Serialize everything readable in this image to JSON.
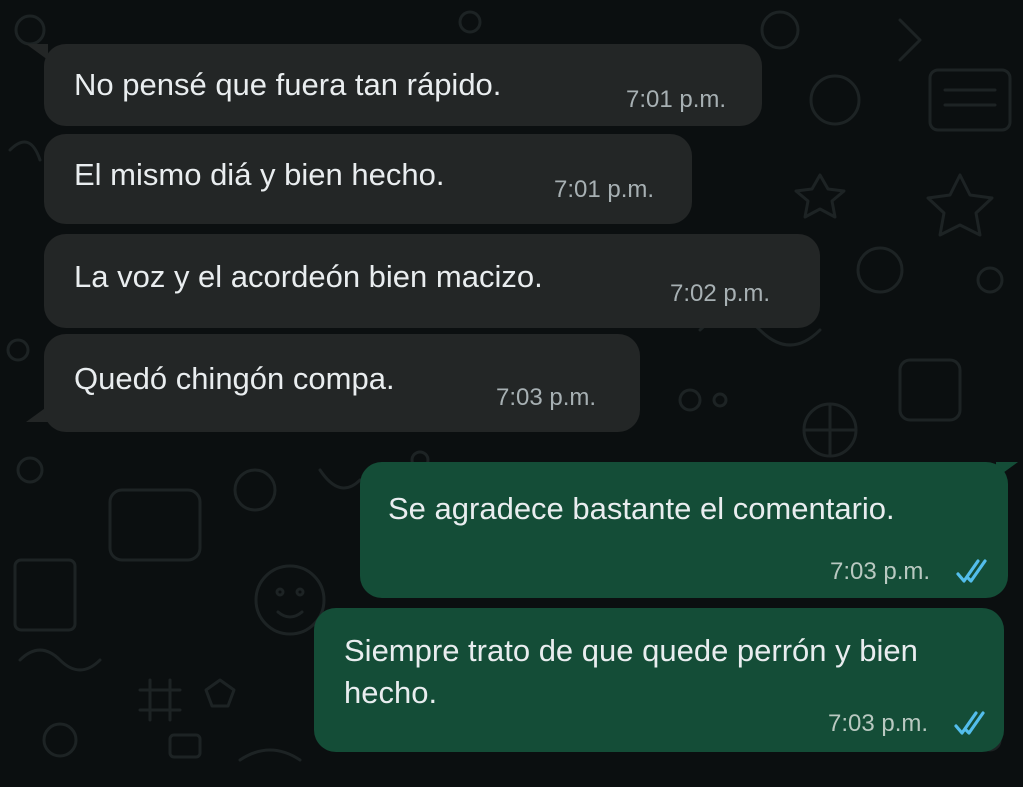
{
  "theme": {
    "incoming_bubble": "#232626",
    "outgoing_bubble": "#144d37",
    "text_color": "#e9edef",
    "read_tick_color": "#53bdeb",
    "background": "#0b0f10"
  },
  "messages": [
    {
      "direction": "incoming",
      "text": "No pensé que fuera tan rápido.",
      "time": "7:01 p.m."
    },
    {
      "direction": "incoming",
      "text": "El mismo diá y bien hecho.",
      "time": "7:01 p.m."
    },
    {
      "direction": "incoming",
      "text": "La voz y el acordeón bien macizo.",
      "time": "7:02 p.m."
    },
    {
      "direction": "incoming",
      "text": "Quedó chingón compa.",
      "time": "7:03 p.m."
    },
    {
      "direction": "outgoing",
      "text": "Se agradece bastante el comentario.",
      "time": "7:03 p.m.",
      "status_icon": "double-check-read-icon"
    },
    {
      "direction": "outgoing",
      "text": "Siempre trato de que quede perrón y bien hecho.",
      "time": "7:03 p.m.",
      "status_icon": "double-check-read-icon"
    }
  ]
}
